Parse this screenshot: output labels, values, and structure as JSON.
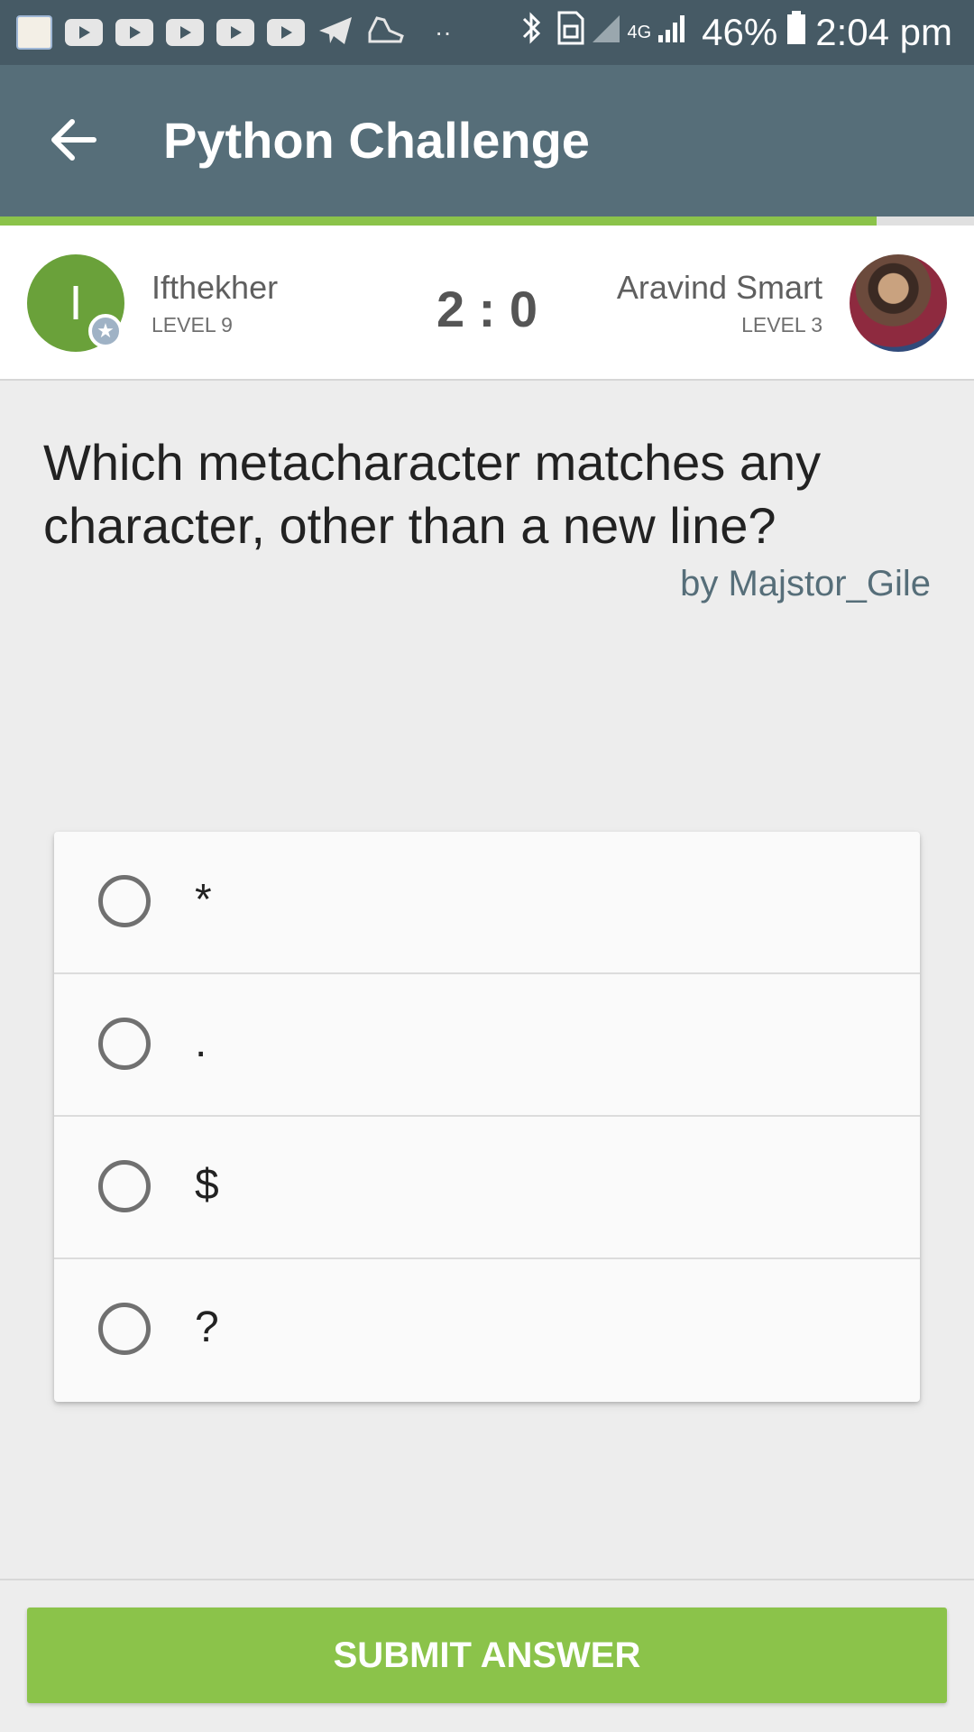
{
  "status_bar": {
    "battery": "46%",
    "time": "2:04 pm",
    "network": "4G",
    "icons": [
      "app-icon",
      "youtube-icon",
      "youtube-icon",
      "youtube-icon",
      "youtube-icon",
      "youtube-icon",
      "telegram-icon",
      "shoe-icon",
      "more-dots-icon",
      "bluetooth-icon",
      "sim-icon",
      "signal-icon",
      "signal-icon",
      "battery-icon"
    ]
  },
  "toolbar": {
    "title": "Python Challenge",
    "back_icon": "arrow-left-icon"
  },
  "progress": {
    "fraction": 0.9,
    "color": "#8bc34a"
  },
  "players": {
    "left": {
      "initial": "I",
      "name": "Ifthekher",
      "level": "LEVEL 9",
      "avatar_color": "#6aa13a"
    },
    "score": "2 : 0",
    "right": {
      "name": "Aravind Smart",
      "level": "LEVEL 3"
    }
  },
  "question": {
    "text": "Which metacharacter matches any character, other than a new line?",
    "author": "by Majstor_Gile"
  },
  "options": [
    "*",
    ".",
    "$",
    "?"
  ],
  "submit": {
    "label": "SUBMIT ANSWER",
    "color": "#8bc34a"
  },
  "colors": {
    "toolbar": "#566e79",
    "status_bar": "#465a65",
    "background": "#ededed"
  }
}
